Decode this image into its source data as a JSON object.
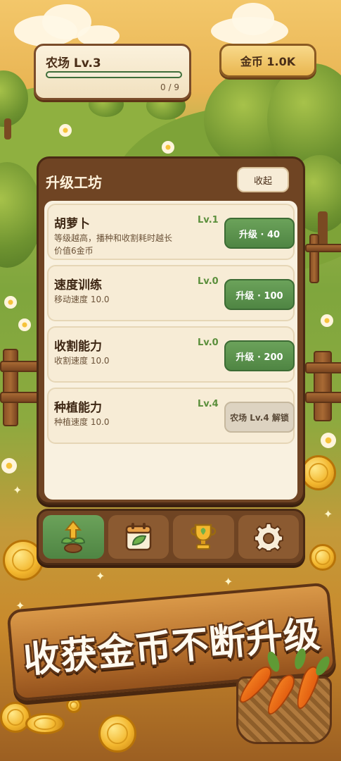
{
  "hud": {
    "farm_title": "农场 Lv.3",
    "farm_progress_text": "0 / 9",
    "farm_progress": 0,
    "gold_label": "金币 1.0K"
  },
  "panel": {
    "title": "升级工坊",
    "collapse_label": "收起",
    "items": [
      {
        "name": "胡萝卜",
        "desc1": "等级越高，播种和收割耗时越长",
        "desc2": "价值6金币",
        "level": "Lv.1",
        "button": "升级 · 40",
        "state": "available"
      },
      {
        "name": "速度训练",
        "desc1": "移动速度 10.0",
        "desc2": "",
        "level": "Lv.0",
        "button": "升级 · 100",
        "state": "available"
      },
      {
        "name": "收割能力",
        "desc1": "收割速度 10.0",
        "desc2": "",
        "level": "Lv.0",
        "button": "升级 · 200",
        "state": "available"
      },
      {
        "name": "种植能力",
        "desc1": "种植速度 10.0",
        "desc2": "",
        "level": "Lv.4",
        "button": "农场 Lv.4 解锁",
        "state": "locked"
      }
    ]
  },
  "nav": {
    "tabs": [
      {
        "icon": "sprout-upgrade-icon",
        "active": true
      },
      {
        "icon": "calendar-leaf-icon",
        "active": false
      },
      {
        "icon": "trophy-icon",
        "active": false
      },
      {
        "icon": "gear-icon",
        "active": false
      }
    ]
  },
  "banner": {
    "text": "收获金币不断升级"
  },
  "colors": {
    "accent_green": "#5b8f3c",
    "panel_brown": "#6f4423",
    "cream": "#f9f1e0",
    "gold": "#f3b72e"
  }
}
